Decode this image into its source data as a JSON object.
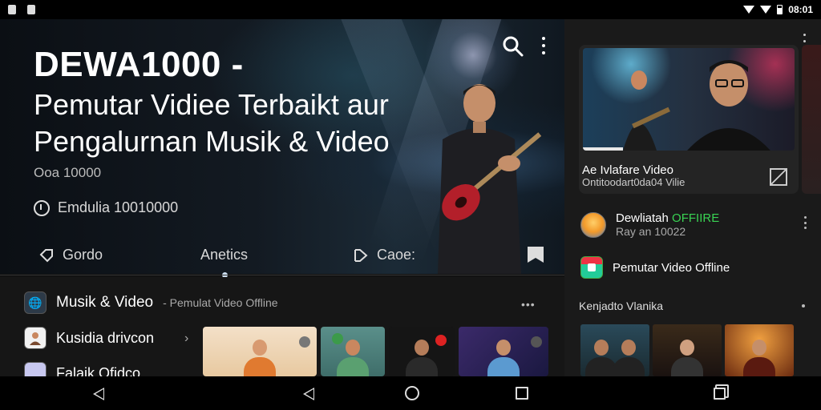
{
  "status_bar": {
    "time": "08:01"
  },
  "hero": {
    "title": "DEWA1000 -",
    "subtitle_line1": "Pemutar Vidiee Terbaikt aur",
    "subtitle_line2": "Pengalurnan Musik & Video",
    "meta": "Ooa 10000",
    "location": "Emdulia 10010000"
  },
  "tabs": [
    {
      "label": "Gordo"
    },
    {
      "label": "Anetics"
    },
    {
      "label": "Caoe:"
    }
  ],
  "list": {
    "header_title": "Musik & Video",
    "header_sub": "- Pemulat Video Offline",
    "header_more": "•••",
    "rows": [
      {
        "label": "Kusidia drivcon"
      },
      {
        "label": "Falaik Ofidco"
      }
    ]
  },
  "right_panel": {
    "featured_title": "Ae Ivlafare Video",
    "featured_sub": "Ontitoodart0da04 Vilie",
    "item1_title": "Dewliatah",
    "item1_status": "OFFIIRE",
    "item1_sub": "Ray an 10022",
    "item2_title": "Pemutar Video Offline",
    "section_label": "Kenjadto Vlanika"
  }
}
